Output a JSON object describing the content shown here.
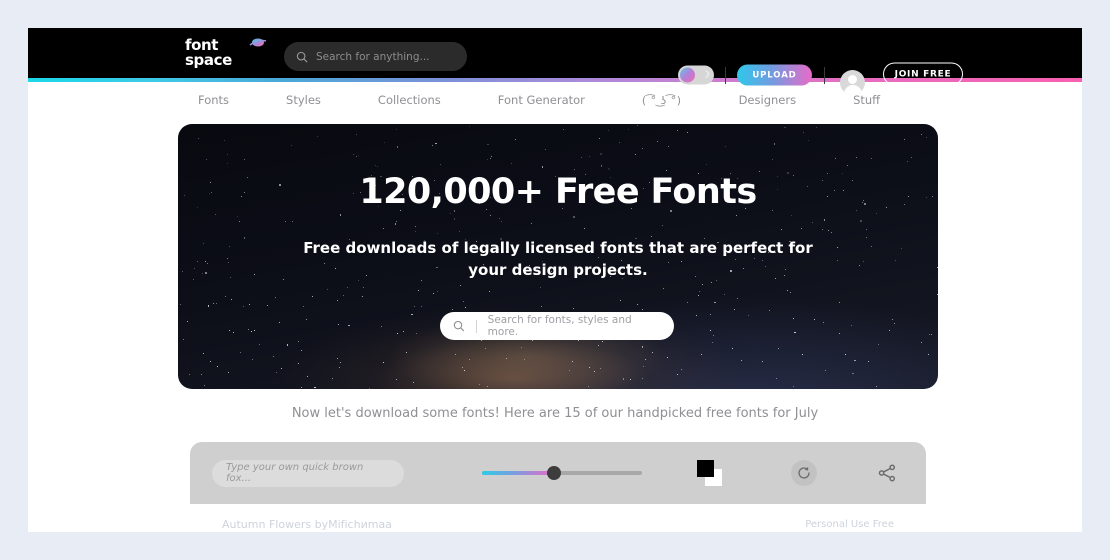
{
  "theme": {
    "page_background": "#e8ecf4",
    "header_background": "#000000",
    "accent_cyan": "#2ecbe8",
    "accent_pink": "#e86bc8",
    "muted_text": "#8f8f94"
  },
  "header": {
    "logo": {
      "line1": "font",
      "line2": "space",
      "icon": "swoosh-icon"
    },
    "search": {
      "placeholder": "Search for anything...",
      "value": "",
      "icon": "search-icon"
    },
    "theme_toggle": {
      "icon": "moon-icon",
      "state": "off"
    },
    "upload_label": "UPLOAD",
    "avatar": {
      "icon": "user-avatar-icon"
    },
    "join_label": "JOIN FREE"
  },
  "nav": {
    "items": [
      {
        "label": "Fonts"
      },
      {
        "label": "Styles"
      },
      {
        "label": "Collections"
      },
      {
        "label": "Font Generator"
      },
      {
        "label": "( ͡° ͜ʖ ͡°)"
      },
      {
        "label": "Designers"
      },
      {
        "label": "Stuff"
      }
    ]
  },
  "hero": {
    "title": "120,000+ Free Fonts",
    "subtitle": "Free downloads of legally licensed fonts that are perfect for your design projects.",
    "search": {
      "placeholder": "Search for fonts, styles and more.",
      "value": "",
      "icon": "search-icon"
    }
  },
  "tagline": "Now let's download some fonts! Here are 15 of our handpicked free fonts for July",
  "toolbar": {
    "preview_input": {
      "placeholder": "Type your own quick brown fox...",
      "value": ""
    },
    "size_slider": {
      "value": 45,
      "min": 0,
      "max": 100
    },
    "color_swatch": {
      "foreground": "#000000",
      "background": "#ffffff",
      "icon": "color-swatch-icon"
    },
    "reset": {
      "icon": "refresh-icon"
    },
    "share": {
      "icon": "share-icon"
    }
  },
  "font_card": {
    "title": "Autumn Flowers byМіfіcһиmаа",
    "license": "Personal Use Free"
  }
}
